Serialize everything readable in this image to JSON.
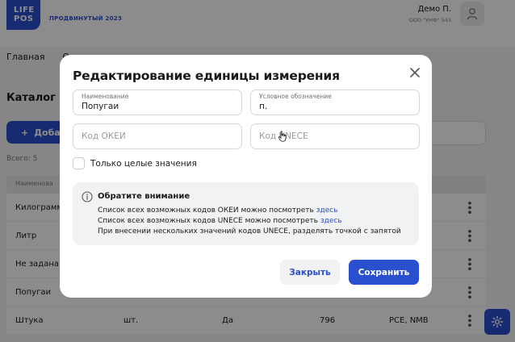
{
  "header": {
    "logo_line1": "LIFE",
    "logo_line2": "POS",
    "plan": "ПРОДВИНУТЫЙ 2023",
    "user_name": "Демо П.",
    "user_org": "ООО \"УНФ\" 543"
  },
  "nav": {
    "items": [
      "Главная",
      "Оп"
    ]
  },
  "page": {
    "title": "Каталог",
    "add_label": "Доба",
    "total": "Всего: 5",
    "column": "Наименова"
  },
  "table": {
    "rows": [
      {
        "name": "Килограмм",
        "short": "",
        "whole": "",
        "okei": "",
        "unece": ""
      },
      {
        "name": "Литр",
        "short": "",
        "whole": "",
        "okei": "",
        "unece": ""
      },
      {
        "name": "Не задана",
        "short": "",
        "whole": "",
        "okei": "",
        "unece": ""
      },
      {
        "name": "Попугаи",
        "short": "",
        "whole": "",
        "okei": "",
        "unece": ""
      },
      {
        "name": "Штука",
        "short": "шт.",
        "whole": "Да",
        "okei": "796",
        "unece": "PCE, NMB"
      }
    ]
  },
  "modal": {
    "title": "Редактирование единицы измерения",
    "name_label": "Наименование",
    "name_value": "Попугаи",
    "short_label": "Условное обозначение",
    "short_value": "п.",
    "okei_placeholder": "Код ОКЕИ",
    "unece_placeholder": "Код UNECE",
    "whole_label": "Только целые значения",
    "note_title": "Обратите внимание",
    "note_line1": "Список всех возможных кодов ОКЕИ можно посмотреть",
    "note_line2": "Список всех возможных кодов UNECE можно посмотреть",
    "note_link": "здесь",
    "note_line3": "При внесении нескольких значений кодов UNECE, разделять точкой с запятой",
    "close_label": "Закрыть",
    "save_label": "Сохранить"
  },
  "colors": {
    "accent": "#2a4fcf",
    "overlay": "rgba(0,0,0,0.45)"
  }
}
